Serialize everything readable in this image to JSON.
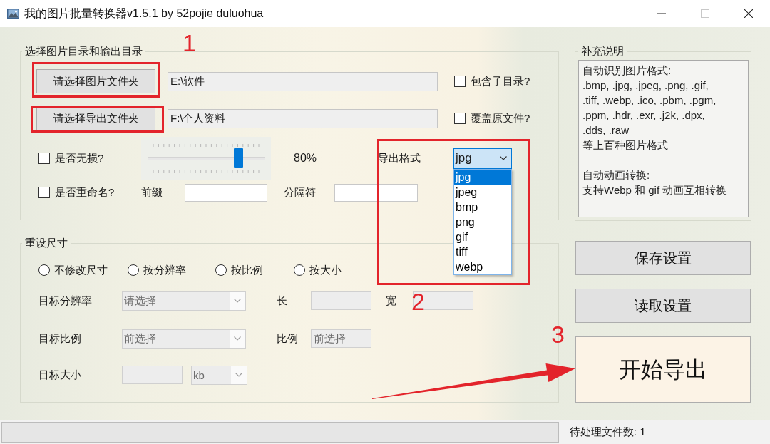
{
  "window": {
    "title": "我的图片批量转换器v1.5.1 by 52pojie duluohua",
    "maximize_disabled": true
  },
  "directories": {
    "title": "选择图片目录和输出目录",
    "rows": [
      {
        "button": "请选择图片文件夹",
        "path": "E:\\软件",
        "option": {
          "label": "包含子目录?",
          "checked": false
        }
      },
      {
        "button": "请选择导出文件夹",
        "path": "F:\\个人资料",
        "option": {
          "label": "覆盖原文件?",
          "checked": false
        }
      }
    ],
    "lossless": {
      "label": "是否无损?",
      "checked": false
    },
    "quality": {
      "level": 0.8,
      "reading": "80%"
    },
    "export_format": {
      "label": "导出格式",
      "value": "jpg",
      "expanded": true,
      "options": [
        {
          "label": "jpg",
          "selected": true
        },
        {
          "label": "jpeg",
          "selected": false
        },
        {
          "label": "bmp",
          "selected": false
        },
        {
          "label": "png",
          "selected": false
        },
        {
          "label": "gif",
          "selected": false
        },
        {
          "label": "tiff",
          "selected": false
        },
        {
          "label": "webp",
          "selected": false
        }
      ]
    },
    "rename": {
      "label": "是否重命名?",
      "checked": false,
      "prefix_label": "前缀",
      "separator_label": "分隔符"
    }
  },
  "resize": {
    "title": "重设尺寸",
    "modes": [
      {
        "label": "不修改尺寸",
        "selected": false
      },
      {
        "label": "按分辨率",
        "selected": false
      },
      {
        "label": "按比例",
        "selected": false
      },
      {
        "label": "按大小",
        "selected": false
      }
    ],
    "rows": [
      {
        "label": "目标分辨率",
        "controls": [
          {
            "kind": "select",
            "value": "请选择",
            "disabled": true
          },
          {
            "kind": "caption",
            "text": "长"
          },
          {
            "kind": "input",
            "disabled": true
          },
          {
            "kind": "caption",
            "text": "宽"
          },
          {
            "kind": "input",
            "disabled": true
          }
        ]
      },
      {
        "label": "目标比例",
        "controls": [
          {
            "kind": "select",
            "value": "前选择",
            "disabled": true
          },
          {
            "kind": "caption",
            "text": "比例"
          },
          {
            "kind": "input",
            "value": "前选择",
            "disabled": true
          }
        ]
      },
      {
        "label": "目标大小",
        "controls": [
          {
            "kind": "input",
            "disabled": true
          },
          {
            "kind": "select",
            "value": "kb",
            "disabled": true
          }
        ]
      }
    ]
  },
  "notes": {
    "title": "补充说明",
    "paragraphs": [
      [
        "自动识别图片格式:",
        ".bmp, .jpg, .jpeg, .png, .gif,",
        ".tiff, .webp, .ico, .pbm, .pgm,",
        ".ppm, .hdr, .exr, .j2k, .dpx,",
        ".dds, .raw",
        "等上百种图片格式"
      ],
      [
        "自动动画转换:",
        "支持Webp 和 gif 动画互相转换"
      ]
    ]
  },
  "actions": [
    {
      "label": "保存设置",
      "kind": "normal"
    },
    {
      "label": "读取设置",
      "kind": "normal"
    },
    {
      "label": "开始导出",
      "kind": "primary"
    }
  ],
  "status_bar": {
    "pending": "待处理文件数: 1"
  },
  "annotations": [
    "1",
    "2",
    "3"
  ]
}
